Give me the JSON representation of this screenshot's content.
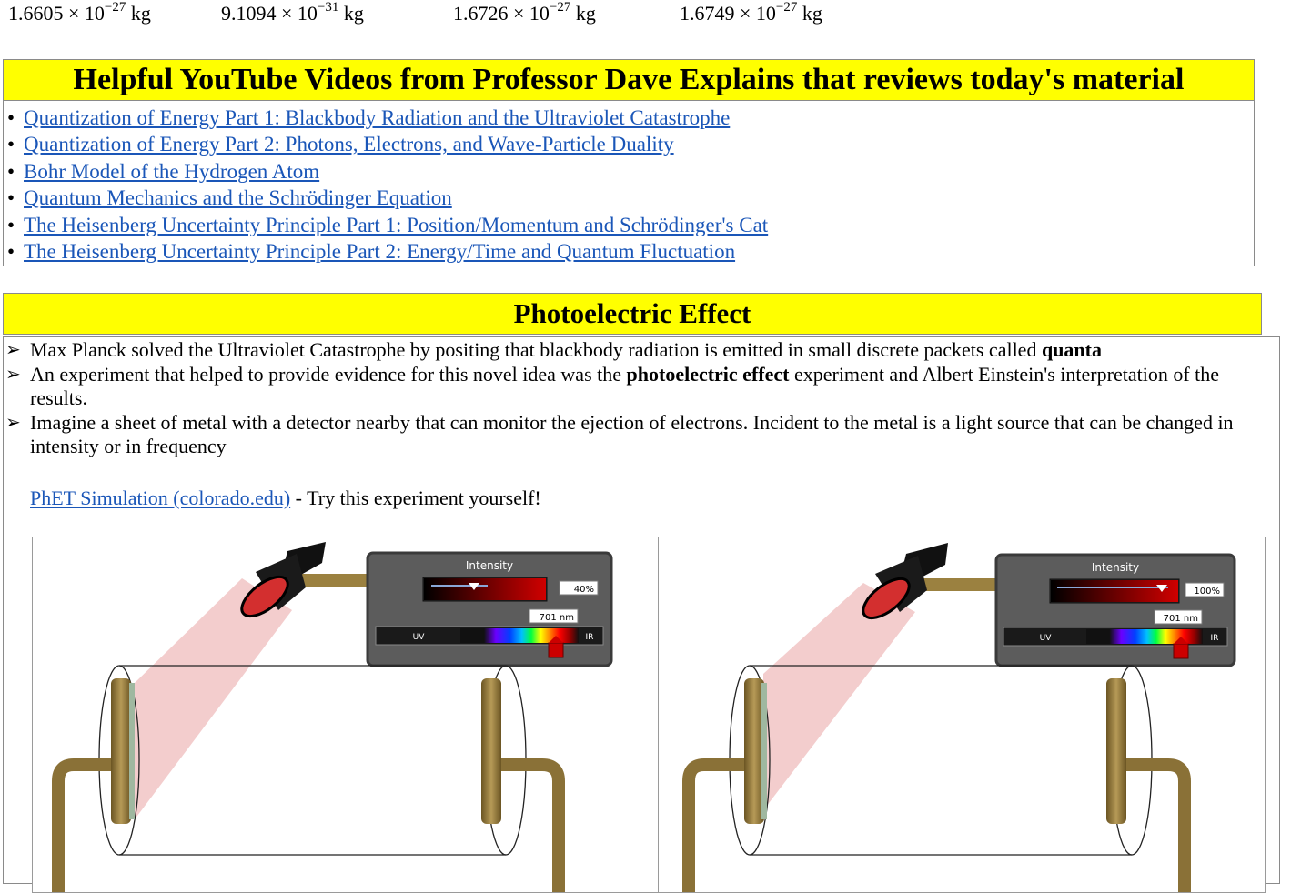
{
  "masses": [
    {
      "mantissa": "1.6605 ×",
      "base": "10",
      "exponent": "−27",
      "unit": "kg"
    },
    {
      "mantissa": "9.1094 ×",
      "base": "10",
      "exponent": "−31",
      "unit": "kg"
    },
    {
      "mantissa": "1.6726 ×",
      "base": "10",
      "exponent": "−27",
      "unit": "kg"
    },
    {
      "mantissa": "1.6749 ×",
      "base": "10",
      "exponent": "−27",
      "unit": "kg"
    }
  ],
  "youtube": {
    "title": "Helpful YouTube Videos from Professor Dave Explains that reviews today's material",
    "links": [
      "Quantization of Energy Part 1: Blackbody Radiation and the Ultraviolet Catastrophe",
      "Quantization of Energy Part 2: Photons, Electrons, and Wave-Particle Duality",
      "Bohr Model of the Hydrogen Atom",
      "Quantum Mechanics and the Schrödinger Equation",
      "The Heisenberg Uncertainty Principle Part 1: Position/Momentum and Schrödinger's Cat",
      "The Heisenberg Uncertainty Principle Part 2: Energy/Time and Quantum Fluctuation"
    ]
  },
  "photoelectric": {
    "title": "Photoelectric Effect",
    "b1_text": "Max Planck solved the Ultraviolet Catastrophe by positing that blackbody radiation is emitted in small discrete packets called ",
    "b1_bold": "quanta",
    "b2_pre": "An experiment that helped to provide evidence for this novel idea was the ",
    "b2_bold": "photoelectric effect",
    "b2_post": " experiment and Albert Einstein's interpretation of the results.",
    "b3_text": "Imagine a sheet of metal with a detector nearby that can monitor the ejection of electrons. Incident to the metal is a light source that can be changed in intensity or in frequency",
    "phet_link": "PhET Simulation (colorado.edu)",
    "phet_suffix": " - Try this experiment yourself!"
  },
  "simulations": [
    {
      "intensity_label": "Intensity",
      "intensity_value": "40%",
      "intensity_level": 0.4,
      "wavelength": "701 nm",
      "uv": "UV",
      "ir": "IR"
    },
    {
      "intensity_label": "Intensity",
      "intensity_value": "100%",
      "intensity_level": 1.0,
      "wavelength": "701 nm",
      "uv": "UV",
      "ir": "IR"
    }
  ],
  "colors": {
    "header_bg": "#ffff00",
    "link": "#1a56b8",
    "beam": "#f2c2c2",
    "panel": "#5a5a5a",
    "wire": "#9b8140"
  }
}
